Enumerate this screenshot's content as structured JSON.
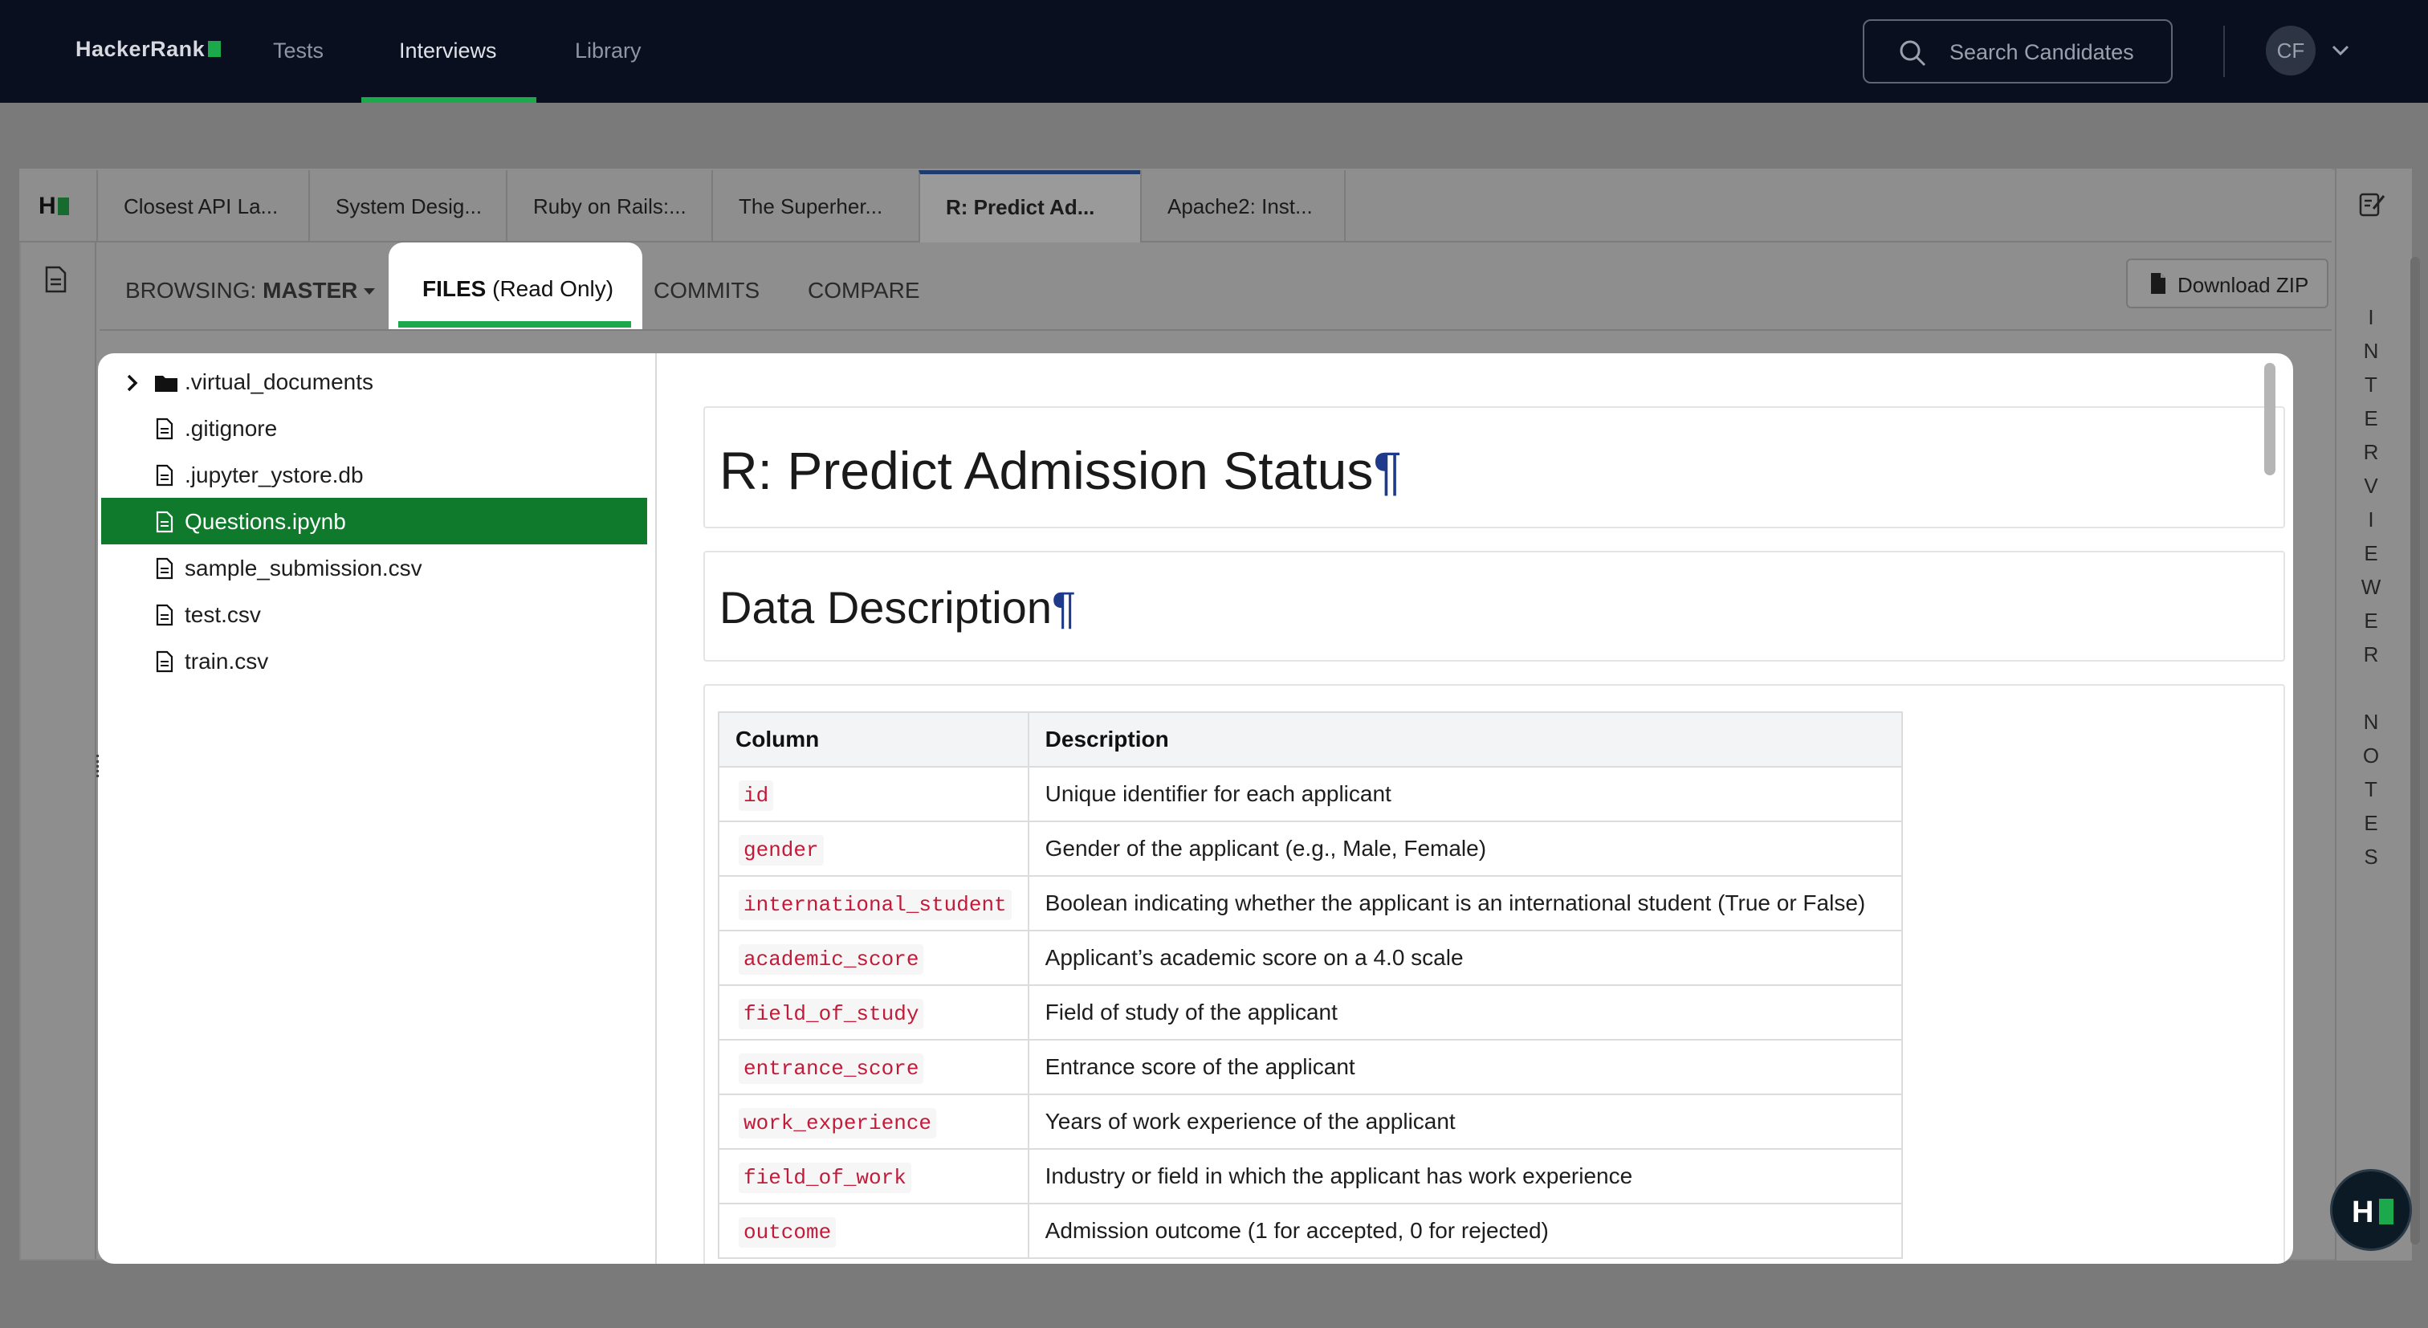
{
  "nav": {
    "logo": "HackerRank",
    "items": [
      "Tests",
      "Interviews",
      "Library"
    ],
    "search_placeholder": "Search Candidates",
    "avatar_initials": "CF"
  },
  "tabs": [
    {
      "label": "Closest API La..."
    },
    {
      "label": "System Desig..."
    },
    {
      "label": "Ruby on Rails:..."
    },
    {
      "label": "The Superher..."
    },
    {
      "label": "R: Predict Ad...",
      "active": true
    },
    {
      "label": "Apache2: Inst..."
    }
  ],
  "browsing": {
    "prefix": "BROWSING:",
    "branch": "MASTER",
    "files_label": "FILES",
    "files_suffix": "(Read Only)",
    "commits": "COMMITS",
    "compare": "COMPARE",
    "download": "Download ZIP"
  },
  "side_notes": "INTERVIEWER NOTES",
  "file_tree": [
    {
      "name": ".virtual_documents",
      "type": "folder"
    },
    {
      "name": ".gitignore",
      "type": "file"
    },
    {
      "name": ".jupyter_ystore.db",
      "type": "file"
    },
    {
      "name": "Questions.ipynb",
      "type": "file",
      "selected": true
    },
    {
      "name": "sample_submission.csv",
      "type": "file"
    },
    {
      "name": "test.csv",
      "type": "file"
    },
    {
      "name": "train.csv",
      "type": "file"
    }
  ],
  "notebook": {
    "title": "R: Predict Admission Status",
    "section": "Data Description",
    "pilcrow": "¶",
    "table_headers": [
      "Column",
      "Description"
    ],
    "rows": [
      [
        "id",
        "Unique identifier for each applicant"
      ],
      [
        "gender",
        "Gender of the applicant (e.g., Male, Female)"
      ],
      [
        "international_student",
        "Boolean indicating whether the applicant is an international student (True or False)"
      ],
      [
        "academic_score",
        "Applicant’s academic score on a 4.0 scale"
      ],
      [
        "field_of_study",
        "Field of study of the applicant"
      ],
      [
        "entrance_score",
        "Entrance score of the applicant"
      ],
      [
        "work_experience",
        "Years of work experience of the applicant"
      ],
      [
        "field_of_work",
        "Industry or field in which the applicant has work experience"
      ],
      [
        "outcome",
        "Admission outcome (1 for accepted, 0 for rejected)"
      ]
    ]
  },
  "colors": {
    "brand_green": "#1ba94c",
    "selected_green": "#0f7a2b",
    "nav_bg": "#0a0f1f",
    "code_red": "#c41a3a"
  }
}
